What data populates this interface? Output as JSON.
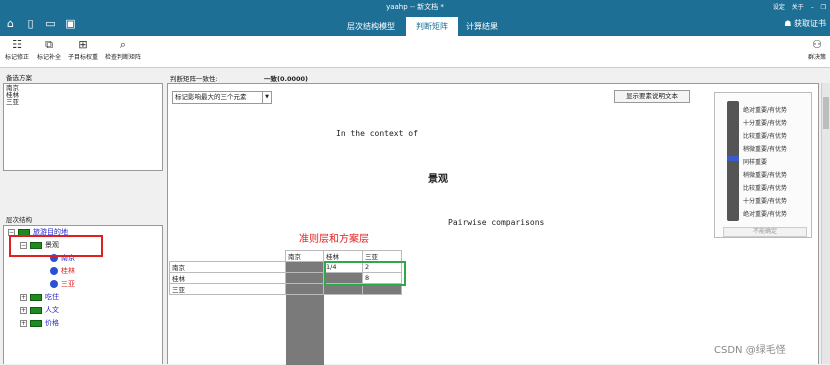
{
  "window": {
    "title": "yaahp -- 新文档 *",
    "controls": [
      "设定",
      "关于",
      "–",
      "❐"
    ]
  },
  "menu": {
    "tabs": [
      "层次结构模型",
      "判断矩阵",
      "计算结果"
    ],
    "active_tab": "判断矩阵",
    "help": "获取证书"
  },
  "toolbar": {
    "buttons": [
      "标记修正",
      "标记补全",
      "子目标权重",
      "检查判断矩阵"
    ],
    "right_button": "群决策"
  },
  "alternatives": {
    "title": "备选方案",
    "items": [
      "南京",
      "桂林",
      "三亚"
    ]
  },
  "hierarchy": {
    "title": "层次结构",
    "root": "旅游目的地",
    "criteria": [
      "景观",
      "吃住",
      "人文",
      "价格"
    ],
    "sub_items": [
      "南京",
      "桂林",
      "三亚"
    ]
  },
  "matrix_header": {
    "consistency_label": "判断矩阵一致性:",
    "consistency_value": "一致(0.0000)",
    "dropdown_value": "标记影响最大的三个元素",
    "show_text_button": "显示要素说明文本",
    "context_text": "In the context of",
    "criterion_name": "景观",
    "pairwise_text": "Pairwise comparisons"
  },
  "annotation": {
    "text": "准则层和方案层",
    "color": "#e02020"
  },
  "matrix": {
    "columns": [
      "南京",
      "桂林",
      "三亚"
    ],
    "rows": [
      {
        "label": "南京",
        "cells": [
          "",
          "1/4",
          "2"
        ]
      },
      {
        "label": "桂林",
        "cells": [
          "",
          "",
          "8"
        ]
      },
      {
        "label": "三亚",
        "cells": [
          "",
          "",
          ""
        ]
      }
    ]
  },
  "scale": {
    "labels": [
      "绝对重要/有优势",
      "十分重要/有优势",
      "比较重要/有优势",
      "稍微重要/有优势",
      "同样重要",
      "稍微重要/有优势",
      "比较重要/有优势",
      "十分重要/有优势",
      "绝对重要/有优势"
    ],
    "button": "不能确定"
  },
  "watermark": "CSDN @绿毛怪",
  "colors": {
    "accent": "#1e6f96",
    "highlight_red": "#e02020",
    "highlight_green": "#2ea84a",
    "tree_link": "#2222cc"
  }
}
